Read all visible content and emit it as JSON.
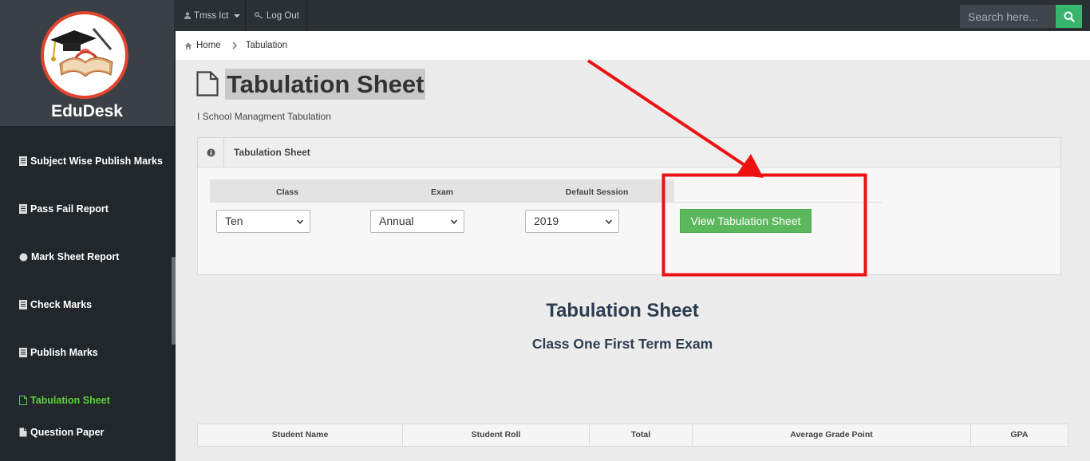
{
  "brand": {
    "name": "EduDesk"
  },
  "sidebar": {
    "items": [
      {
        "label": "Subject Wise Publish Marks",
        "icon": "document-icon"
      },
      {
        "label": "Pass Fail Report",
        "icon": "document-icon"
      },
      {
        "label": "Mark Sheet Report",
        "icon": "circle-icon"
      },
      {
        "label": "Check Marks",
        "icon": "document-icon"
      },
      {
        "label": "Publish Marks",
        "icon": "document-icon"
      },
      {
        "label": "Tabulation Sheet",
        "icon": "file-icon",
        "active": true
      },
      {
        "label": "Question Paper",
        "icon": "file-icon"
      }
    ]
  },
  "topbar": {
    "user_label": "Tmss Ict",
    "logout_label": "Log Out",
    "search_placeholder": "Search here..."
  },
  "breadcrumb": {
    "home": "Home",
    "current": "Tabulation"
  },
  "page": {
    "title": "Tabulation Sheet",
    "subtitle": "I School Managment Tabulation"
  },
  "panel": {
    "title": "Tabulation Sheet",
    "filters": {
      "class_label": "Class",
      "exam_label": "Exam",
      "session_label": "Default Session",
      "class_value": "Ten",
      "exam_value": "Annual",
      "session_value": "2019"
    },
    "button_label": "View Tabulation Sheet"
  },
  "result": {
    "title": "Tabulation Sheet",
    "subtitle": "Class One First Term Exam",
    "columns": [
      "Student Name",
      "Student Roll",
      "Total",
      "Average Grade Point",
      "GPA"
    ]
  },
  "colors": {
    "sidebar_bg": "#2b3035",
    "active_menu": "#5cd13a",
    "button_green": "#5cb85c",
    "search_green": "#39b66d",
    "annotation_red": "#ee1111",
    "heading_navy": "#2d3e50"
  }
}
